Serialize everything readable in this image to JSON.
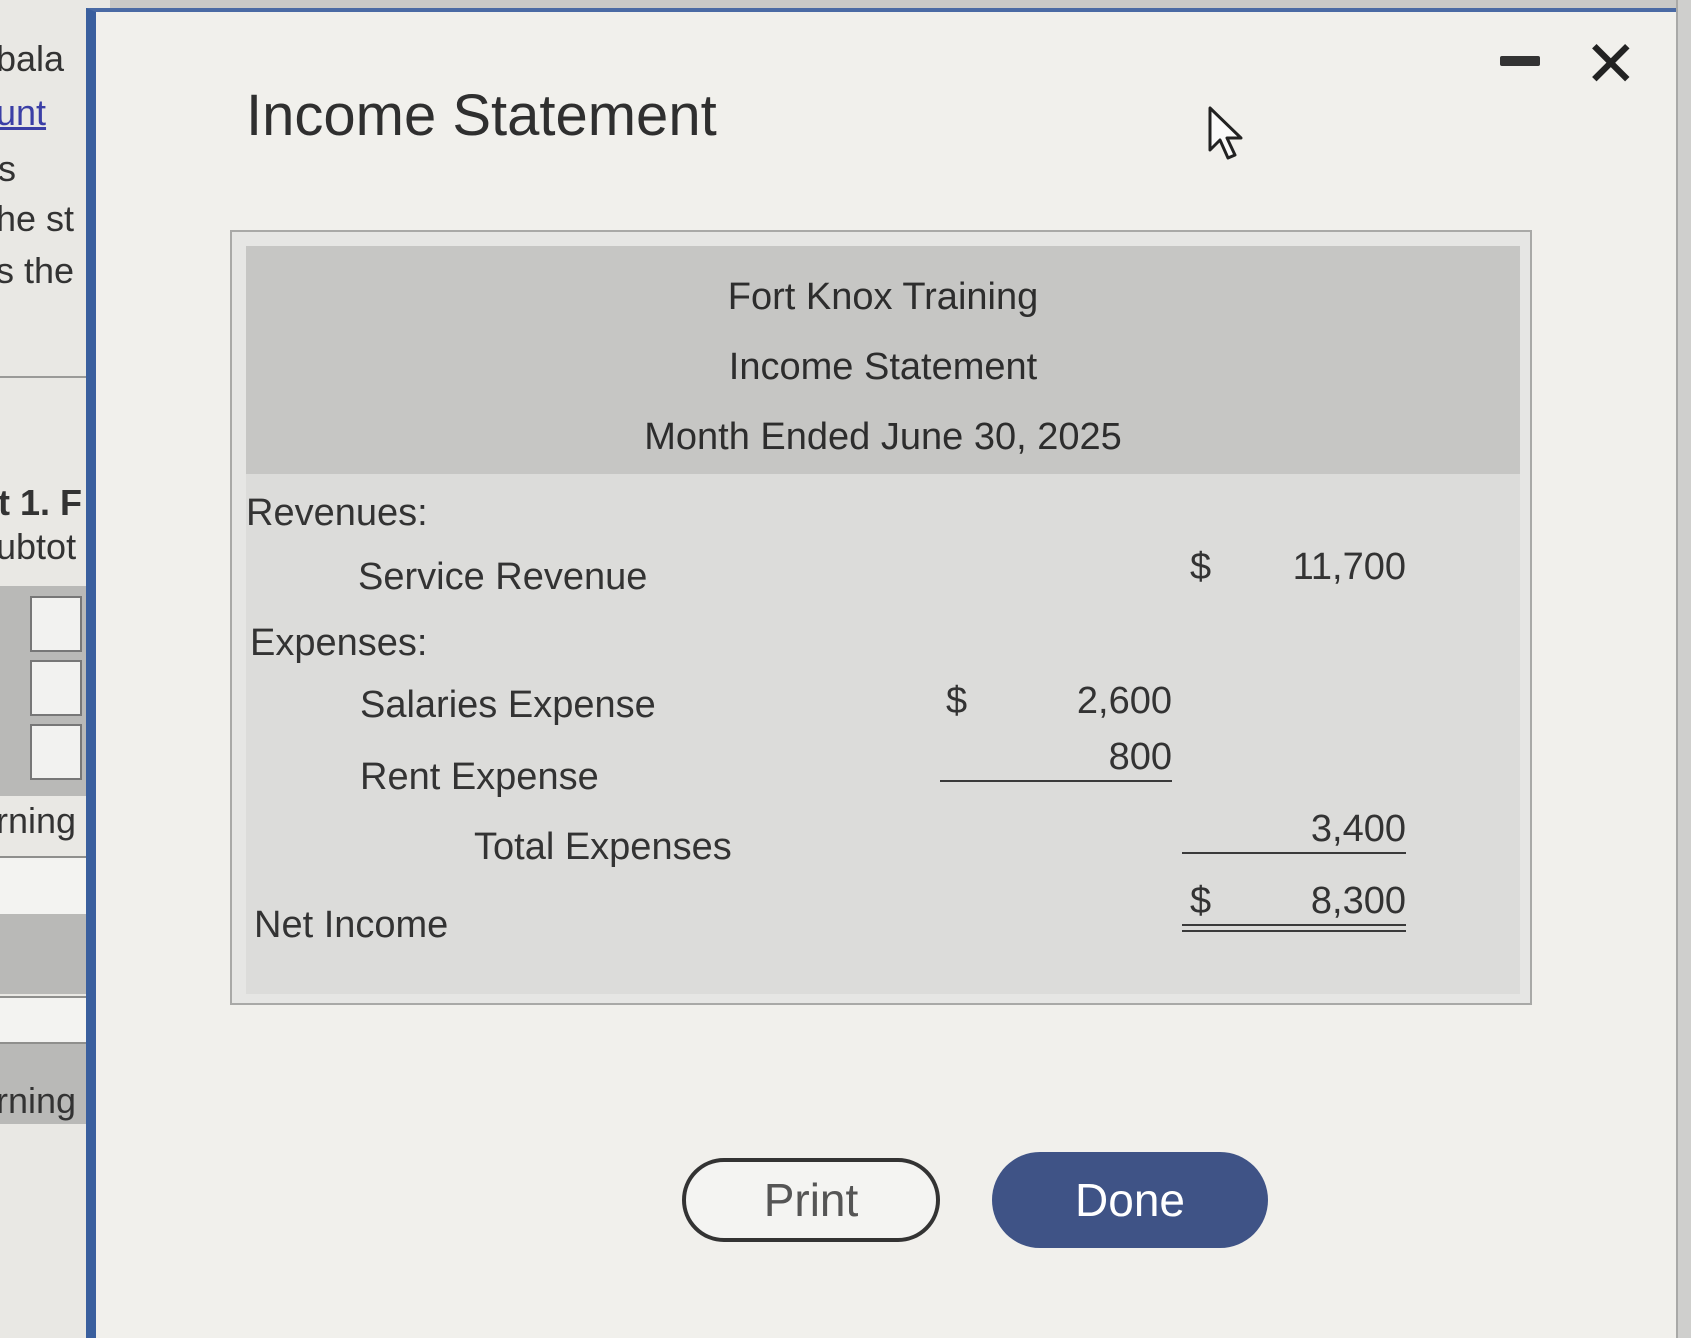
{
  "background": {
    "fragments": [
      "bala",
      "unt",
      "s",
      "he st",
      "s the",
      "t 1. F",
      "ubtot",
      "rning",
      "rning"
    ]
  },
  "window": {
    "title": "Income Statement",
    "minimize_label": "—",
    "close_label": "✕"
  },
  "statement": {
    "company": "Fort Knox Training",
    "title": "Income Statement",
    "period": "Month Ended June 30, 2025",
    "revenues_label": "Revenues:",
    "revenues": [
      {
        "label": "Service Revenue",
        "currency": "$",
        "amount": "11,700"
      }
    ],
    "expenses_label": "Expenses:",
    "expenses": [
      {
        "label": "Salaries Expense",
        "currency": "$",
        "amount": "2,600"
      },
      {
        "label": "Rent Expense",
        "currency": "",
        "amount": "800"
      }
    ],
    "total_expenses": {
      "label": "Total Expenses",
      "amount": "3,400"
    },
    "net_income": {
      "label": "Net Income",
      "currency": "$",
      "amount": "8,300"
    }
  },
  "buttons": {
    "print": "Print",
    "done": "Done"
  },
  "colors": {
    "window_border": "#3a5f9e",
    "done_button": "#3f5386",
    "header_band": "#c6c6c4"
  }
}
